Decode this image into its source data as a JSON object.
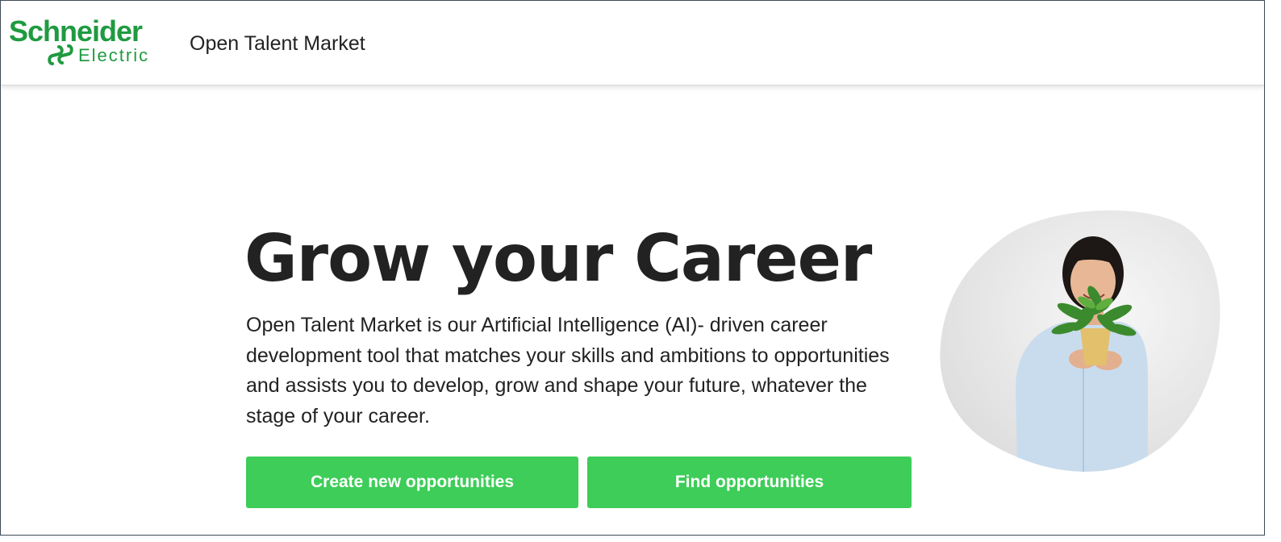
{
  "header": {
    "logo": {
      "brand": "Schneider",
      "sub": "Electric",
      "icon": "schneider-electric-logo-icon",
      "color": "#1f9a40"
    },
    "app_title": "Open Talent Market"
  },
  "hero": {
    "title": "Grow your Career",
    "description": "Open Talent Market is our Artificial Intelligence (AI)- driven career development tool that matches your skills and ambitions to opportunities and assists you to develop, grow and shape your future, whatever the stage of your career.",
    "buttons": {
      "create_label": "Create new opportunities",
      "find_label": "Find opportunities"
    },
    "button_color": "#3dcd58",
    "image": "woman-holding-plant-photo"
  }
}
